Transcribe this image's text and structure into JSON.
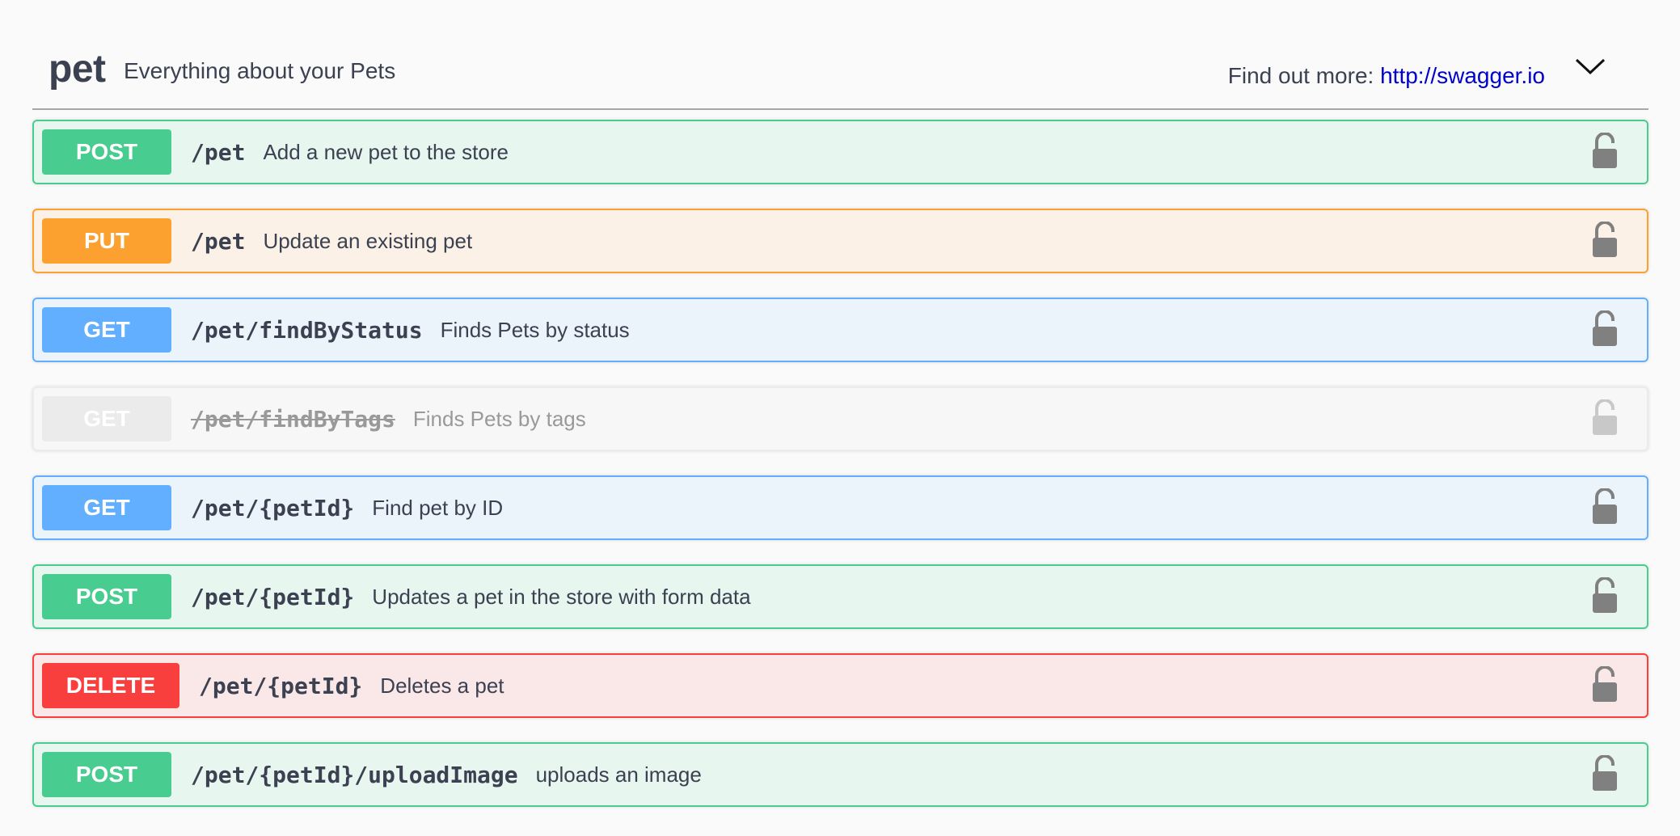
{
  "tag": {
    "name": "pet",
    "description": "Everything about your Pets",
    "external_prefix": "Find out more: ",
    "external_link": "http://swagger.io"
  },
  "operations": [
    {
      "method": "POST",
      "path": "/pet",
      "summary": "Add a new pet to the store",
      "deprecated": false
    },
    {
      "method": "PUT",
      "path": "/pet",
      "summary": "Update an existing pet",
      "deprecated": false
    },
    {
      "method": "GET",
      "path": "/pet/findByStatus",
      "summary": "Finds Pets by status",
      "deprecated": false
    },
    {
      "method": "GET",
      "path": "/pet/findByTags",
      "summary": "Finds Pets by tags",
      "deprecated": true
    },
    {
      "method": "GET",
      "path": "/pet/{petId}",
      "summary": "Find pet by ID",
      "deprecated": false
    },
    {
      "method": "POST",
      "path": "/pet/{petId}",
      "summary": "Updates a pet in the store with form data",
      "deprecated": false
    },
    {
      "method": "DELETE",
      "path": "/pet/{petId}",
      "summary": "Deletes a pet",
      "deprecated": false
    },
    {
      "method": "POST",
      "path": "/pet/{petId}/uploadImage",
      "summary": "uploads an image",
      "deprecated": false
    }
  ],
  "colors": {
    "post": "#49cc90",
    "put": "#fca130",
    "get": "#61affe",
    "delete": "#f93e3e",
    "deprecated": "#ebebeb",
    "link": "#0000cc"
  },
  "icons": {
    "toggle": "chevron-down-icon",
    "authorize": "lock-icon"
  }
}
